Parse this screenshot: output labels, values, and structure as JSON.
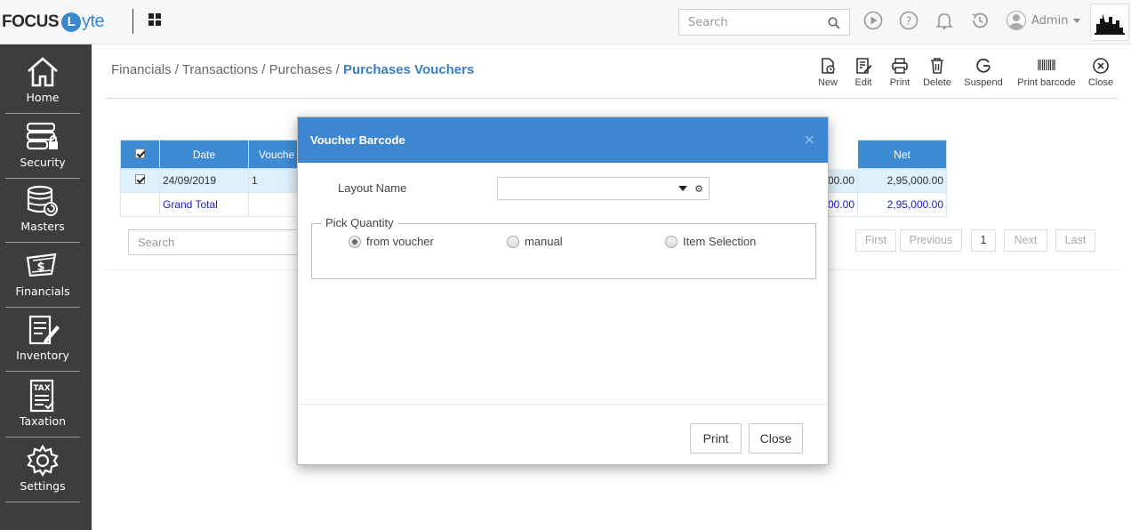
{
  "app": {
    "logo_word": "FOCUS",
    "logo_mark": "L",
    "logo_rest": "yte"
  },
  "topbar": {
    "search_placeholder": "Search",
    "user_name": "Admin",
    "icons": [
      "apps-grid-icon",
      "play-icon",
      "help-icon",
      "bell-icon",
      "history-icon",
      "user-avatar-icon",
      "company-logo"
    ]
  },
  "sidebar": {
    "items": [
      {
        "label": "Home",
        "icon": "home-icon"
      },
      {
        "label": "Security",
        "icon": "security-icon"
      },
      {
        "label": "Masters",
        "icon": "masters-icon"
      },
      {
        "label": "Financials",
        "icon": "financials-icon"
      },
      {
        "label": "Inventory",
        "icon": "inventory-icon"
      },
      {
        "label": "Taxation",
        "icon": "taxation-icon"
      },
      {
        "label": "Settings",
        "icon": "settings-icon"
      }
    ],
    "tax_icon_text": "TAX"
  },
  "breadcrumb": {
    "items": [
      "Financials /",
      "Transactions /",
      "Purchases /"
    ],
    "active": "Purchases Vouchers"
  },
  "toolbar": {
    "new": "New",
    "edit": "Edit",
    "print": "Print",
    "delete": "Delete",
    "suspend": "Suspend",
    "print_barcode": "Print barcode",
    "close": "Close"
  },
  "grid": {
    "columns": [
      "Date",
      "Vouche",
      "Net"
    ],
    "rows": [
      {
        "checked": true,
        "date": "24/09/2019",
        "voucher": "1",
        "hidden_amount": "00.00",
        "net": "2,95,000.00"
      }
    ],
    "total": {
      "label": "Grand Total",
      "hidden_amount": "00.00",
      "net": "2,95,000.00"
    },
    "search_placeholder": "Search",
    "pager": {
      "first": "First",
      "previous": "Previous",
      "page": "1",
      "next": "Next",
      "last": "Last"
    }
  },
  "modal": {
    "title": "Voucher Barcode",
    "close_glyph": "×",
    "layout_label": "Layout Name",
    "layout_value": "",
    "gear_glyph": "⚙",
    "pick_quantity_legend": "Pick Quantity",
    "options": [
      {
        "label": "from voucher",
        "selected": true
      },
      {
        "label": "manual",
        "selected": false
      },
      {
        "label": "Item Selection",
        "selected": false
      }
    ],
    "print_button": "Print",
    "close_button": "Close"
  },
  "colors": {
    "accent": "#3d87d1",
    "sidebar_bg": "#3d3d3d",
    "total_text": "#1a1acc"
  }
}
